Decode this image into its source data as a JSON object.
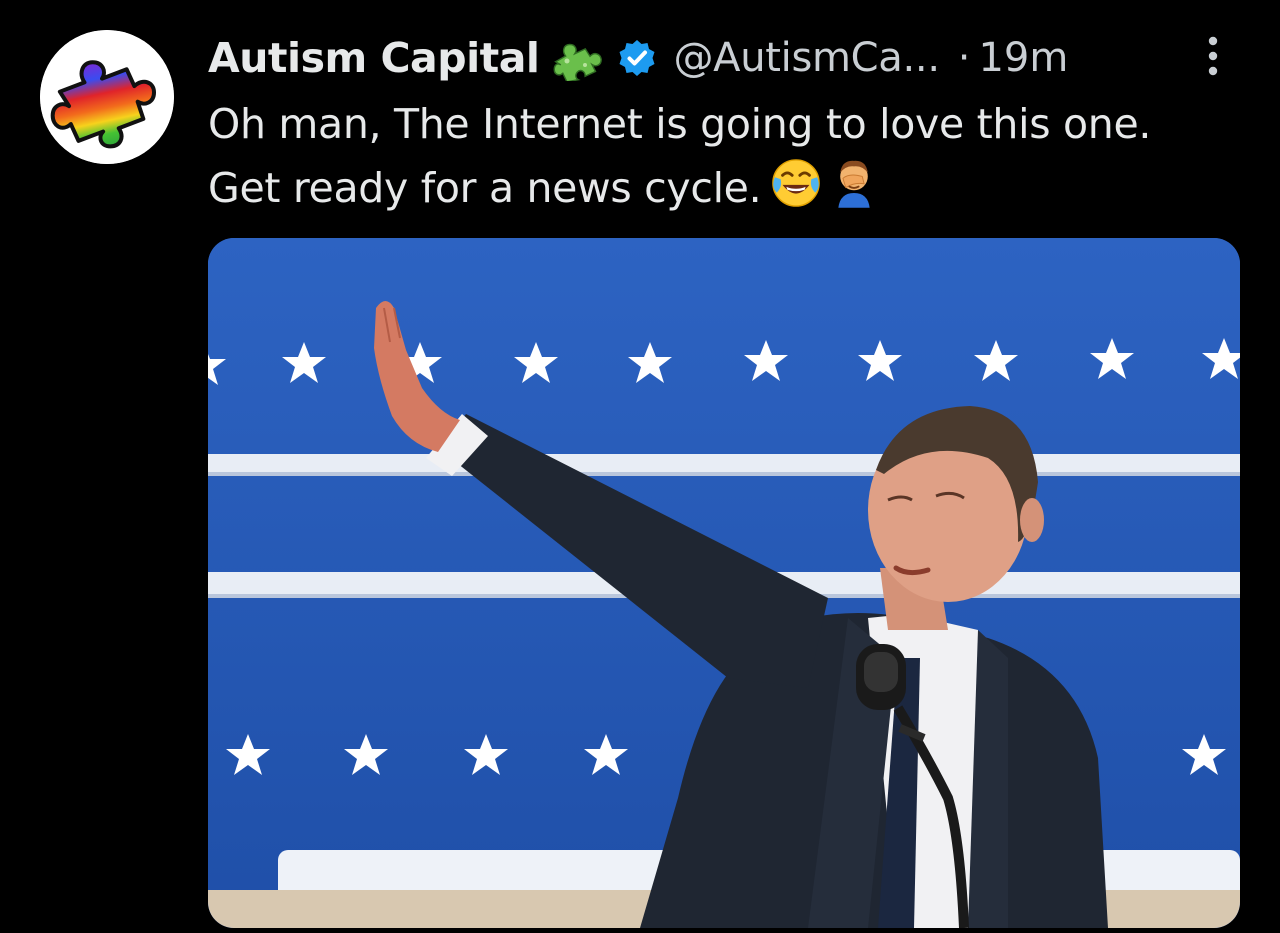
{
  "author": {
    "display_name": "Autism Capital",
    "handle": "@AutismCa...",
    "separator": "·",
    "timestamp": "19m",
    "avatar_icon": "rainbow-puzzle-piece-icon",
    "badge_icon": "green-puzzle-piece-icon",
    "verified_icon": "blue-verified-checkmark-icon"
  },
  "tweet": {
    "line1": "Oh man, The Internet is going to love this one.",
    "line2": "Get ready for a news cycle.",
    "emojis": [
      "face-with-tears-of-joy-icon",
      "man-facepalming-icon"
    ]
  },
  "menu": {
    "icon": "more-vertical-icon"
  },
  "media": {
    "description_icon": "photo-image",
    "background_color": "#2a62c6"
  },
  "colors": {
    "background": "#000000",
    "text": "#e7e9ea",
    "secondary_text": "#c9ced3",
    "verified_blue": "#1d9bf0",
    "puzzle_green": "#6abf4b"
  }
}
